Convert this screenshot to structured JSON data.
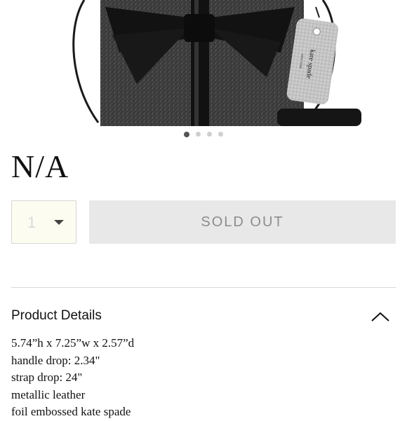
{
  "product": {
    "price": "N/A",
    "brand_tag": "kate spade",
    "brand_tag_sub": "NEW YORK"
  },
  "carousel": {
    "count": 4,
    "active": 1
  },
  "purchase": {
    "quantity": "1",
    "sold_out_label": "SOLD OUT"
  },
  "details": {
    "title": "Product Details",
    "specs": [
      "5.74”h x 7.25”w x 2.57”d",
      "handle drop: 2.34\"",
      "strap drop: 24\"",
      "metallic leather",
      "foil embossed kate spade"
    ]
  },
  "icons": {
    "quantity_dropdown": "caret-down-icon",
    "details_toggle": "chevron-up-icon"
  },
  "colors": {
    "sold_out_bg": "#e8e8e8",
    "quantity_bg": "#fdfcf0",
    "bag": "#2a2a2a"
  }
}
